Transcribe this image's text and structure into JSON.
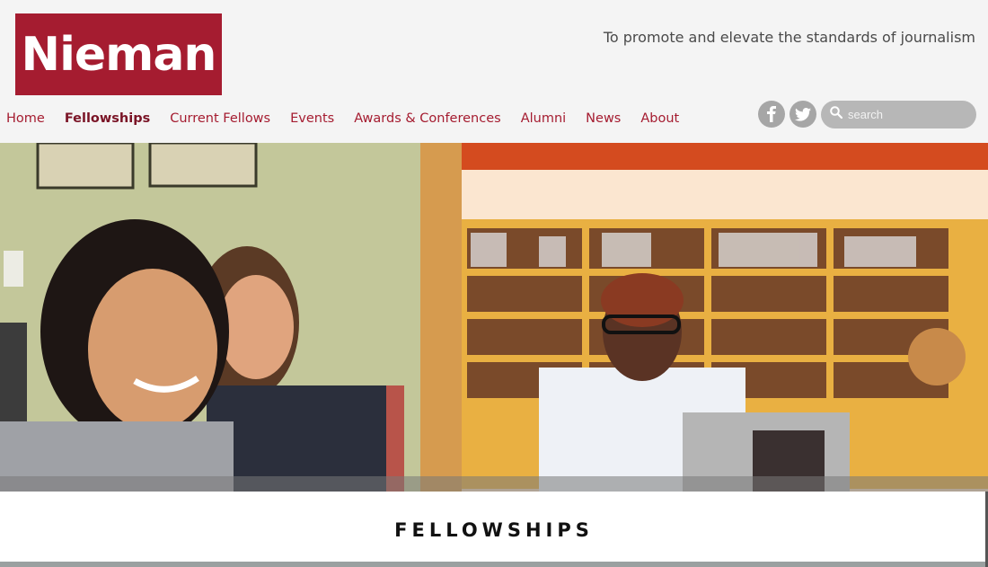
{
  "brand": {
    "logo_text": "Nieman",
    "logo_color": "#a51c30"
  },
  "tagline": "To promote and elevate the standards of journalism",
  "nav": {
    "items": [
      {
        "label": "Home",
        "active": false
      },
      {
        "label": "Fellowships",
        "active": true
      },
      {
        "label": "Current Fellows",
        "active": false
      },
      {
        "label": "Events",
        "active": false
      },
      {
        "label": "Awards & Conferences",
        "active": false
      },
      {
        "label": "Alumni",
        "active": false
      },
      {
        "label": "News",
        "active": false
      },
      {
        "label": "About",
        "active": false
      }
    ]
  },
  "social": {
    "icons": [
      "facebook-icon",
      "twitter-icon"
    ]
  },
  "search": {
    "placeholder": "search"
  },
  "hero": {
    "description_icon": "photo"
  },
  "page": {
    "section_title": "FELLOWSHIPS"
  }
}
